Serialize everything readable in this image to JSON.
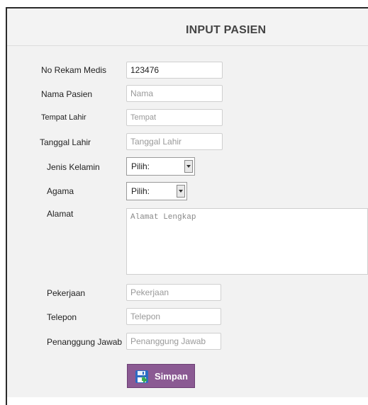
{
  "title": "INPUT PASIEN",
  "fields": {
    "no_rekam_medis": {
      "label": "No Rekam Medis",
      "value": "123476"
    },
    "nama_pasien": {
      "label": "Nama Pasien",
      "placeholder": "Nama"
    },
    "tempat_lahir": {
      "label": "Tempat Lahir",
      "placeholder": "Tempat"
    },
    "tanggal_lahir": {
      "label": "Tanggal Lahir",
      "placeholder": "Tanggal Lahir"
    },
    "jenis_kelamin": {
      "label": "Jenis Kelamin",
      "selected": "Pilih:"
    },
    "agama": {
      "label": "Agama",
      "selected": "Pilih:"
    },
    "alamat": {
      "label": "Alamat",
      "placeholder": "Alamat Lengkap"
    },
    "pekerjaan": {
      "label": "Pekerjaan",
      "placeholder": "Pekerjaan"
    },
    "telepon": {
      "label": "Telepon",
      "placeholder": "Telepon"
    },
    "penanggung_jawab": {
      "label": "Penanggung Jawab",
      "placeholder": "Penanggung Jawab"
    }
  },
  "submit_button": {
    "label": "Simpan",
    "icon": "save-icon"
  },
  "colors": {
    "button": "#8b5a93",
    "panel": "#f2f2f2",
    "header": "#f3f3f3"
  }
}
